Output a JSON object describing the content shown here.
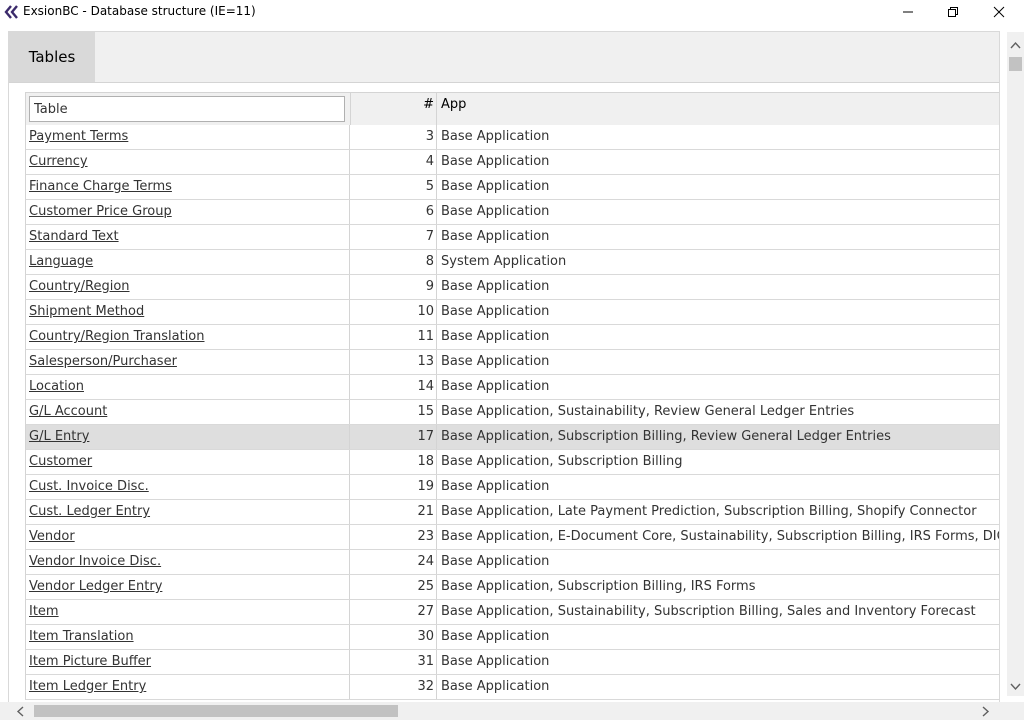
{
  "window": {
    "title": "ExsionBC - Database structure (IE=11)",
    "controls": [
      "minimize-icon",
      "restore-icon",
      "close-icon"
    ]
  },
  "tabs": [
    {
      "label": "Tables",
      "active": true
    }
  ],
  "table": {
    "filter_placeholder": "Table",
    "columns": {
      "number": "#",
      "app": "App"
    },
    "rows": [
      {
        "name": "Payment Terms",
        "number": "3",
        "app": "Base Application"
      },
      {
        "name": "Currency",
        "number": "4",
        "app": "Base Application"
      },
      {
        "name": "Finance Charge Terms",
        "number": "5",
        "app": "Base Application"
      },
      {
        "name": "Customer Price Group",
        "number": "6",
        "app": "Base Application"
      },
      {
        "name": "Standard Text",
        "number": "7",
        "app": "Base Application"
      },
      {
        "name": "Language",
        "number": "8",
        "app": "System Application"
      },
      {
        "name": "Country/Region",
        "number": "9",
        "app": "Base Application"
      },
      {
        "name": "Shipment Method",
        "number": "10",
        "app": "Base Application"
      },
      {
        "name": "Country/Region Translation",
        "number": "11",
        "app": "Base Application"
      },
      {
        "name": "Salesperson/Purchaser",
        "number": "13",
        "app": "Base Application"
      },
      {
        "name": "Location",
        "number": "14",
        "app": "Base Application"
      },
      {
        "name": "G/L Account",
        "number": "15",
        "app": "Base Application, Sustainability, Review General Ledger Entries"
      },
      {
        "name": "G/L Entry",
        "number": "17",
        "app": "Base Application, Subscription Billing, Review General Ledger Entries",
        "selected": true
      },
      {
        "name": "Customer",
        "number": "18",
        "app": "Base Application, Subscription Billing"
      },
      {
        "name": "Cust. Invoice Disc.",
        "number": "19",
        "app": "Base Application"
      },
      {
        "name": "Cust. Ledger Entry",
        "number": "21",
        "app": "Base Application, Late Payment Prediction, Subscription Billing, Shopify Connector"
      },
      {
        "name": "Vendor",
        "number": "23",
        "app": "Base Application, E-Document Core, Sustainability, Subscription Billing, IRS Forms, DIOT - Locali"
      },
      {
        "name": "Vendor Invoice Disc.",
        "number": "24",
        "app": "Base Application"
      },
      {
        "name": "Vendor Ledger Entry",
        "number": "25",
        "app": "Base Application, Subscription Billing, IRS Forms"
      },
      {
        "name": "Item",
        "number": "27",
        "app": "Base Application, Sustainability, Subscription Billing, Sales and Inventory Forecast"
      },
      {
        "name": "Item Translation",
        "number": "30",
        "app": "Base Application"
      },
      {
        "name": "Item Picture Buffer",
        "number": "31",
        "app": "Base Application"
      },
      {
        "name": "Item Ledger Entry",
        "number": "32",
        "app": "Base Application"
      }
    ]
  },
  "colors": {
    "panel_bg": "#f0f0f0",
    "tab_bg": "#d9d9d9",
    "selected_row": "#dedede",
    "scroll_thumb": "#c2c2c2"
  }
}
